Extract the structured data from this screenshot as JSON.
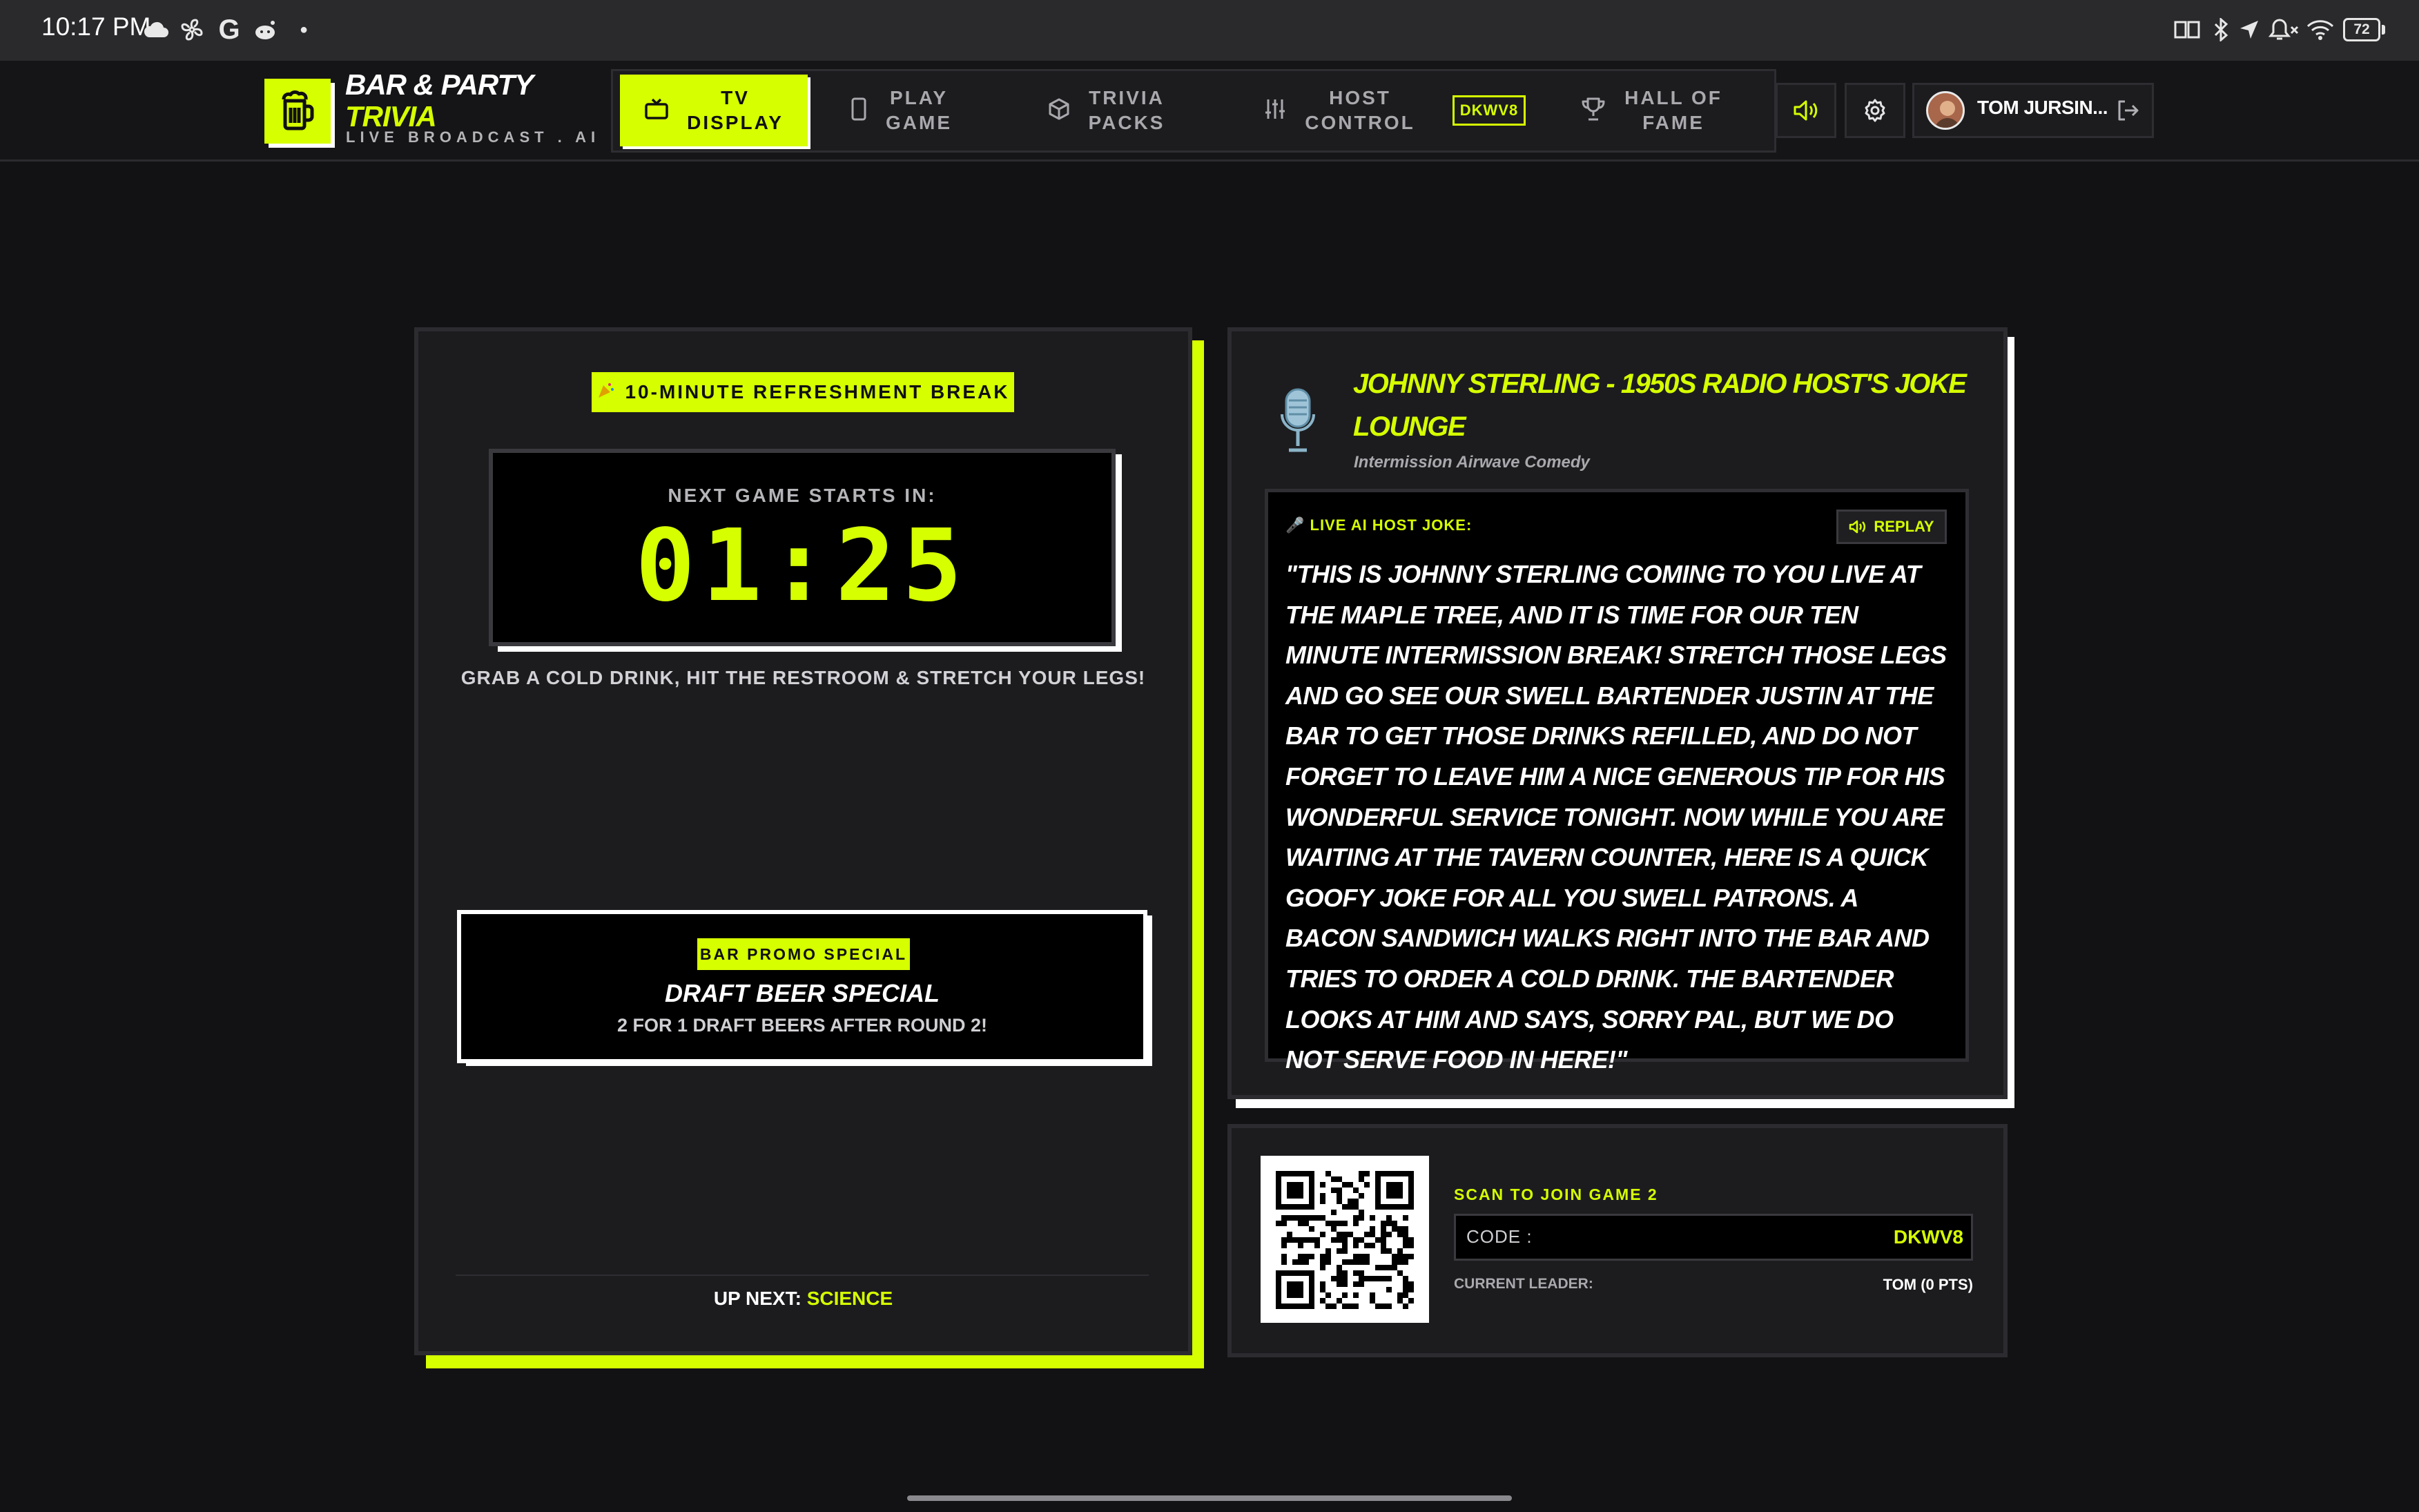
{
  "status_bar": {
    "time": "10:17 PM",
    "left_icons": [
      "cloud-icon",
      "fan-icon",
      "google-icon",
      "reddit-icon",
      "dot-icon"
    ],
    "right_icons": [
      "reading-mode-icon",
      "bluetooth-icon",
      "location-icon",
      "muted-bell-icon",
      "wifi-icon"
    ],
    "battery": "72"
  },
  "app": {
    "brand_line1": "BAR & PARTY",
    "brand_line2": "TRIVIA",
    "tagline": "LIVE BROADCAST . AI",
    "accent_color": "#d6ff00"
  },
  "nav": {
    "items": [
      {
        "line1": "TV",
        "line2": "DISPLAY",
        "icon": "tv-icon",
        "active": true
      },
      {
        "line1": "PLAY",
        "line2": "GAME",
        "icon": "phone-icon",
        "active": false
      },
      {
        "line1": "TRIVIA",
        "line2": "PACKS",
        "icon": "box-icon",
        "active": false
      },
      {
        "line1": "HOST",
        "line2": "CONTROL",
        "icon": "sliders-icon",
        "active": false
      },
      {
        "line1": "HALL OF",
        "line2": "FAME",
        "icon": "trophy-icon",
        "active": false
      }
    ],
    "game_code": "DKWV8"
  },
  "header_actions": {
    "sound_icon": "speaker-icon",
    "settings_icon": "gear-icon",
    "user_name": "TOM JURSIN...",
    "logout_icon": "logout-icon"
  },
  "break_panel": {
    "badge": "10-MINUTE REFRESHMENT BREAK",
    "countdown_label": "NEXT GAME STARTS IN:",
    "countdown": "01:25",
    "tip": "GRAB A COLD DRINK, HIT THE RESTROOM & STRETCH YOUR LEGS!",
    "promo_badge": "BAR PROMO SPECIAL",
    "promo_title": "DRAFT BEER SPECIAL",
    "promo_subtitle": "2 FOR 1 DRAFT BEERS AFTER ROUND 2!",
    "up_next_label": "UP NEXT:",
    "up_next_value": "SCIENCE"
  },
  "joke_panel": {
    "title": "JOHNNY STERLING - 1950S RADIO HOST'S JOKE LOUNGE",
    "subtitle": "Intermission Airwave Comedy",
    "label": "🎤 LIVE AI HOST JOKE:",
    "replay": "REPLAY",
    "text": "\"THIS IS JOHNNY STERLING COMING TO YOU LIVE AT THE MAPLE TREE, AND IT IS TIME FOR OUR TEN MINUTE INTERMISSION BREAK! STRETCH THOSE LEGS AND GO SEE OUR SWELL BARTENDER JUSTIN AT THE BAR TO GET THOSE DRINKS REFILLED, AND DO NOT FORGET TO LEAVE HIM A NICE GENEROUS TIP FOR HIS WONDERFUL SERVICE TONIGHT. NOW WHILE YOU ARE WAITING AT THE TAVERN COUNTER, HERE IS A QUICK GOOFY JOKE FOR ALL YOU SWELL PATRONS. A BACON SANDWICH WALKS RIGHT INTO THE BAR AND TRIES TO ORDER A COLD DRINK. THE BARTENDER LOOKS AT HIM AND SAYS, SORRY PAL, BUT WE DO NOT SERVE FOOD IN HERE!\""
  },
  "join_panel": {
    "scan_label": "SCAN TO JOIN GAME 2",
    "code_label": "CODE :",
    "code_value": "DKWV8",
    "leader_label": "CURRENT LEADER:",
    "leader_value": "TOM (0 PTS)"
  }
}
